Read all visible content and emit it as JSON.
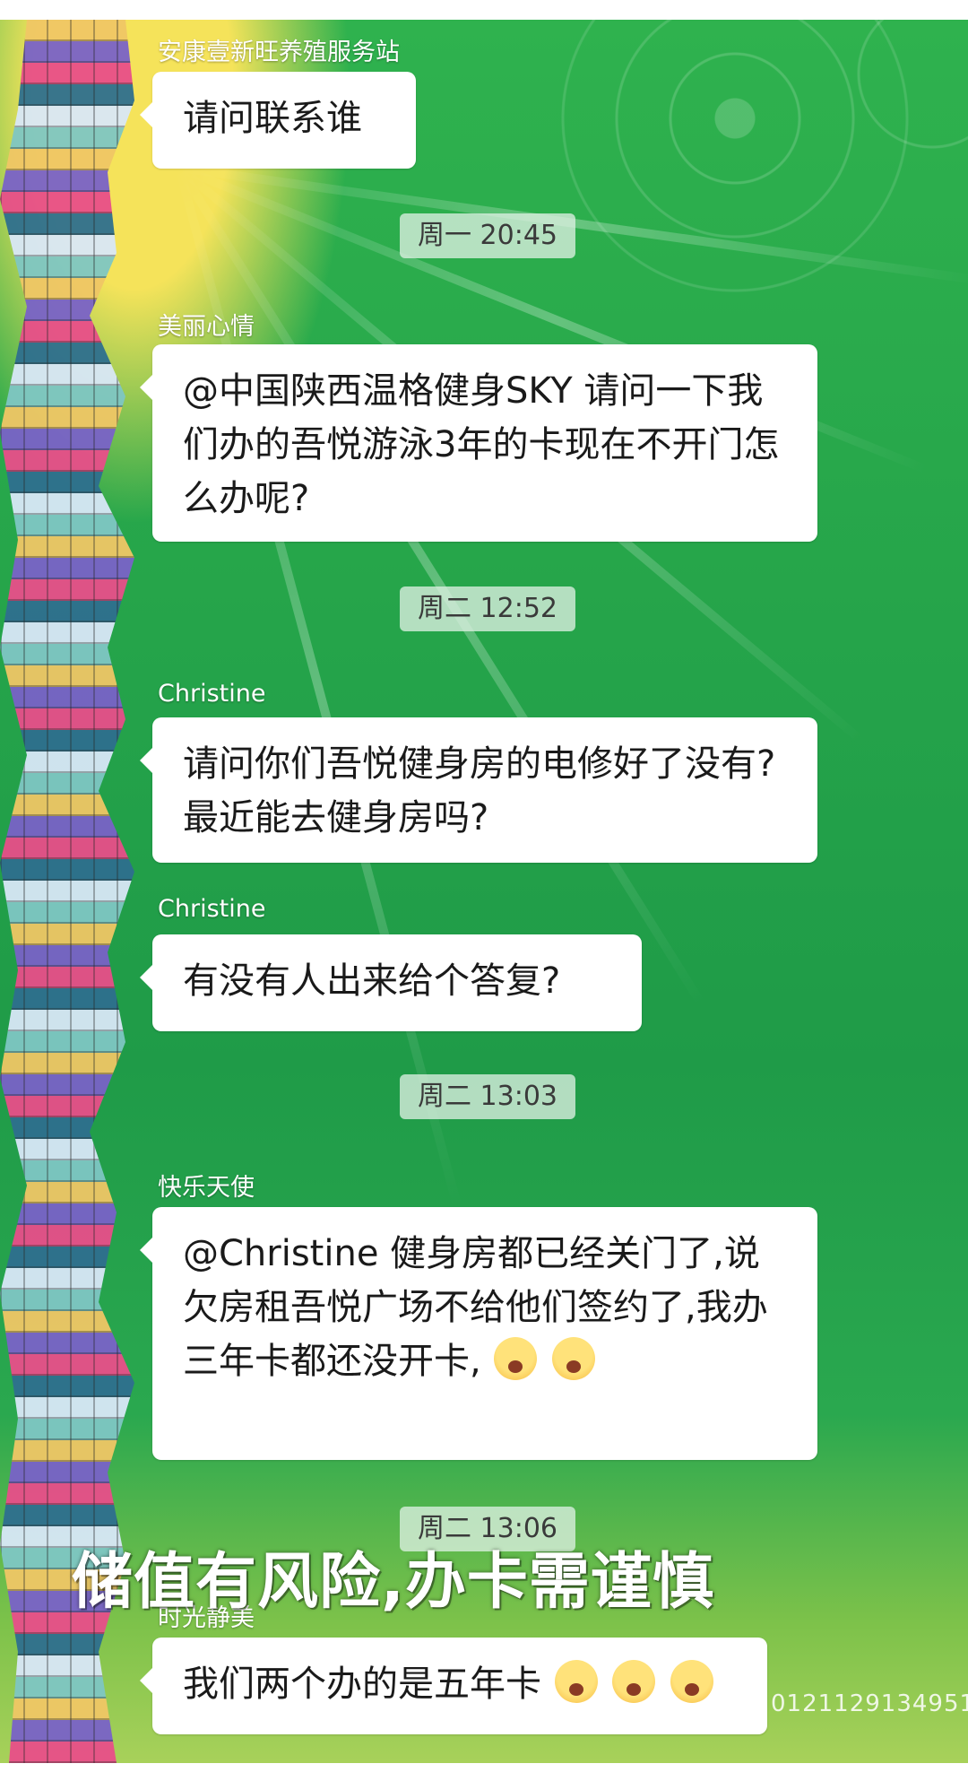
{
  "chat": {
    "messages": [
      {
        "sender": "安康壹新旺养殖服务站",
        "text": "请问联系谁"
      },
      {
        "sender": "美丽心情",
        "text": "@中国陕西温格健身SKY 请问一下我们办的吾悦游泳3年的卡现在不开门怎么办呢?"
      },
      {
        "sender": "Christine",
        "text": "请问你们吾悦健身房的电修好了没有?最近能去健身房吗?"
      },
      {
        "sender": "Christine",
        "text": "有没有人出来给个答复?"
      },
      {
        "sender": "快乐天使",
        "text": "@Christine 健身房都已经关门了,说欠房租吾悦广场不给他们签约了,我办三年卡都还没开卡,"
      },
      {
        "sender": "时光静美",
        "text": "我们两个办的是五年卡"
      }
    ],
    "timestamps": [
      "周一 20:45",
      "周二 12:52",
      "周二 13:03",
      "周二 13:06"
    ]
  },
  "overlay": {
    "caption": "储值有风险,办卡需谨慎",
    "watermark_fragment": "0121129134951"
  },
  "icons": {
    "emoji_laugh_cry": "laughing-tears-emoji-icon",
    "emoji_shocked": "shocked-face-emoji-icon"
  },
  "colors": {
    "chat_bg_green": "#25a44a",
    "bubble_white": "#ffffff",
    "timestamp_bg": "#dcf0e2"
  }
}
